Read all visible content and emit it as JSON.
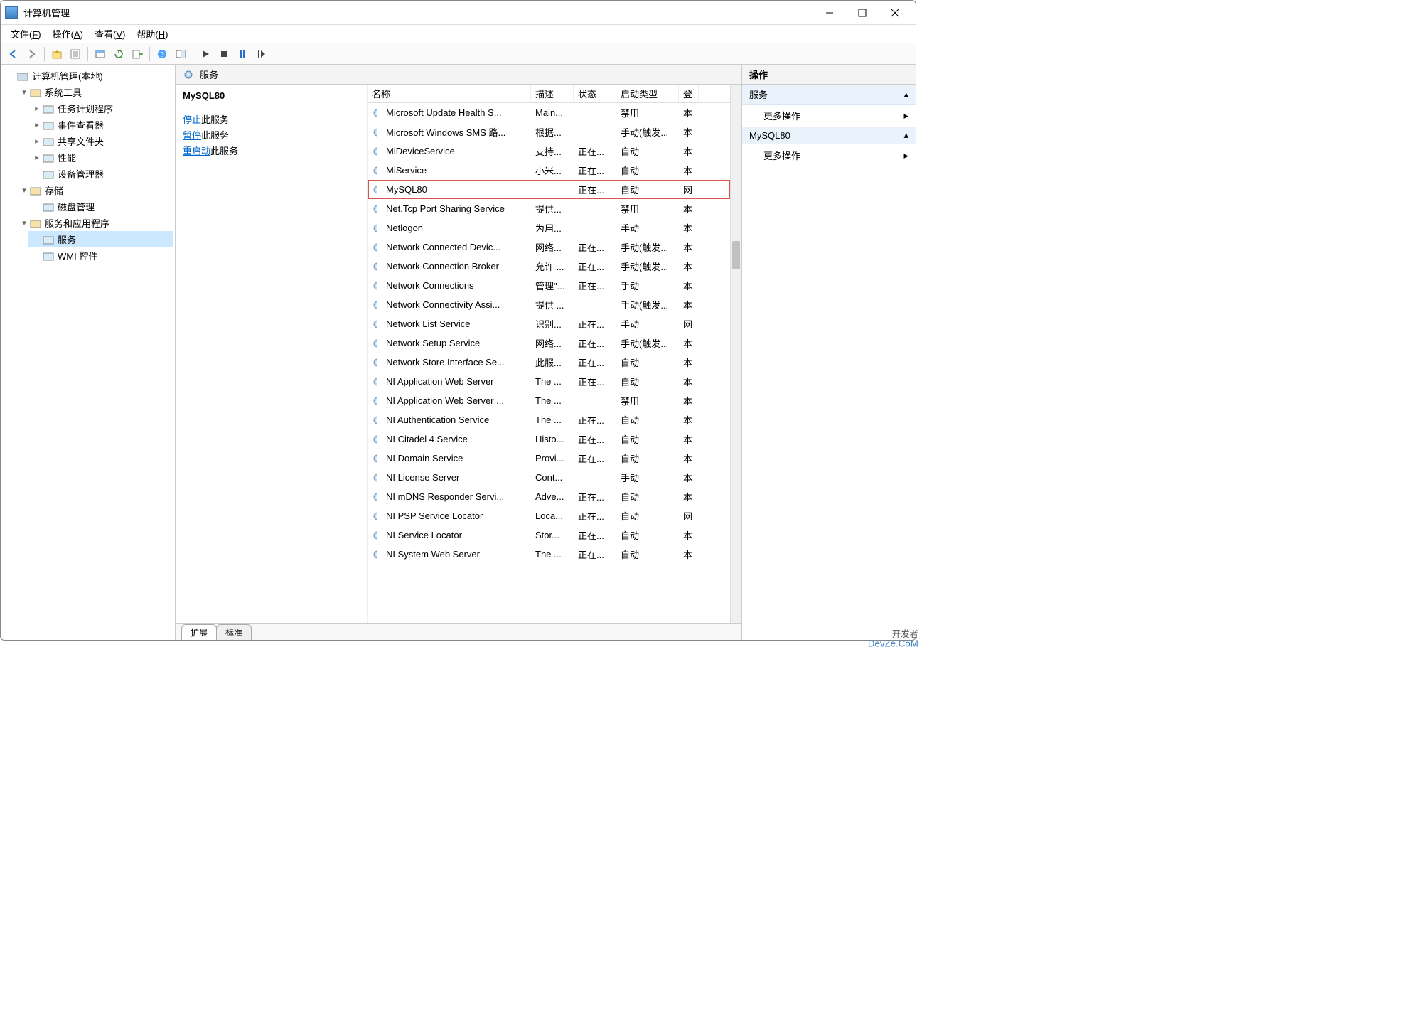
{
  "window": {
    "title": "计算机管理"
  },
  "menus": [
    {
      "label": "文件",
      "hotkey": "F"
    },
    {
      "label": "操作",
      "hotkey": "A"
    },
    {
      "label": "查看",
      "hotkey": "V"
    },
    {
      "label": "帮助",
      "hotkey": "H"
    }
  ],
  "tree": {
    "root": "计算机管理(本地)",
    "groups": [
      {
        "label": "系统工具",
        "expanded": true,
        "children": [
          "任务计划程序",
          "事件查看器",
          "共享文件夹",
          "性能",
          "设备管理器"
        ]
      },
      {
        "label": "存储",
        "expanded": true,
        "children": [
          "磁盘管理"
        ]
      },
      {
        "label": "服务和应用程序",
        "expanded": true,
        "children": [
          "服务",
          "WMI 控件"
        ],
        "selected": "服务"
      }
    ]
  },
  "middle": {
    "header": "服务",
    "selected_name": "MySQL80",
    "action_links": {
      "stop": "停止",
      "stop_suffix": "此服务",
      "pause": "暂停",
      "pause_suffix": "此服务",
      "restart": "重启动",
      "restart_suffix": "此服务"
    },
    "columns": {
      "name": "名称",
      "desc": "描述",
      "status": "状态",
      "startup": "启动类型",
      "logon": "登"
    },
    "tabs": {
      "extended": "扩展",
      "standard": "标准"
    }
  },
  "services": [
    {
      "name": "Microsoft Update Health S...",
      "desc": "Main...",
      "status": "",
      "startup": "禁用",
      "logon": "本"
    },
    {
      "name": "Microsoft Windows SMS 路...",
      "desc": "根据...",
      "status": "",
      "startup": "手动(触发...",
      "logon": "本"
    },
    {
      "name": "MiDeviceService",
      "desc": "支持...",
      "status": "正在...",
      "startup": "自动",
      "logon": "本"
    },
    {
      "name": "MiService",
      "desc": "小米...",
      "status": "正在...",
      "startup": "自动",
      "logon": "本"
    },
    {
      "name": "MySQL80",
      "desc": "",
      "status": "正在...",
      "startup": "自动",
      "logon": "网",
      "highlighted": true
    },
    {
      "name": "Net.Tcp Port Sharing Service",
      "desc": "提供...",
      "status": "",
      "startup": "禁用",
      "logon": "本"
    },
    {
      "name": "Netlogon",
      "desc": "为用...",
      "status": "",
      "startup": "手动",
      "logon": "本"
    },
    {
      "name": "Network Connected Devic...",
      "desc": "网络...",
      "status": "正在...",
      "startup": "手动(触发...",
      "logon": "本"
    },
    {
      "name": "Network Connection Broker",
      "desc": "允许 ...",
      "status": "正在...",
      "startup": "手动(触发...",
      "logon": "本"
    },
    {
      "name": "Network Connections",
      "desc": "管理\"...",
      "status": "正在...",
      "startup": "手动",
      "logon": "本"
    },
    {
      "name": "Network Connectivity Assi...",
      "desc": "提供 ...",
      "status": "",
      "startup": "手动(触发...",
      "logon": "本"
    },
    {
      "name": "Network List Service",
      "desc": "识别...",
      "status": "正在...",
      "startup": "手动",
      "logon": "网"
    },
    {
      "name": "Network Setup Service",
      "desc": "网络...",
      "status": "正在...",
      "startup": "手动(触发...",
      "logon": "本"
    },
    {
      "name": "Network Store Interface Se...",
      "desc": "此服...",
      "status": "正在...",
      "startup": "自动",
      "logon": "本"
    },
    {
      "name": "NI Application Web Server",
      "desc": "The ...",
      "status": "正在...",
      "startup": "自动",
      "logon": "本"
    },
    {
      "name": "NI Application Web Server ...",
      "desc": "The ...",
      "status": "",
      "startup": "禁用",
      "logon": "本"
    },
    {
      "name": "NI Authentication Service",
      "desc": "The ...",
      "status": "正在...",
      "startup": "自动",
      "logon": "本"
    },
    {
      "name": "NI Citadel 4 Service",
      "desc": "Histo...",
      "status": "正在...",
      "startup": "自动",
      "logon": "本"
    },
    {
      "name": "NI Domain Service",
      "desc": "Provi...",
      "status": "正在...",
      "startup": "自动",
      "logon": "本"
    },
    {
      "name": "NI License Server",
      "desc": "Cont...",
      "status": "",
      "startup": "手动",
      "logon": "本"
    },
    {
      "name": "NI mDNS Responder Servi...",
      "desc": "Adve...",
      "status": "正在...",
      "startup": "自动",
      "logon": "本"
    },
    {
      "name": "NI PSP Service Locator",
      "desc": "Loca...",
      "status": "正在...",
      "startup": "自动",
      "logon": "网"
    },
    {
      "name": "NI Service Locator",
      "desc": "Stor...",
      "status": "正在...",
      "startup": "自动",
      "logon": "本"
    },
    {
      "name": "NI System Web Server",
      "desc": "The ...",
      "status": "正在...",
      "startup": "自动",
      "logon": "本"
    }
  ],
  "actions_pane": {
    "header": "操作",
    "sections": [
      {
        "title": "服务",
        "items": [
          "更多操作"
        ]
      },
      {
        "title": "MySQL80",
        "items": [
          "更多操作"
        ]
      }
    ]
  },
  "watermark": {
    "top": "开发者",
    "bottom": "DevZe.CoM"
  }
}
